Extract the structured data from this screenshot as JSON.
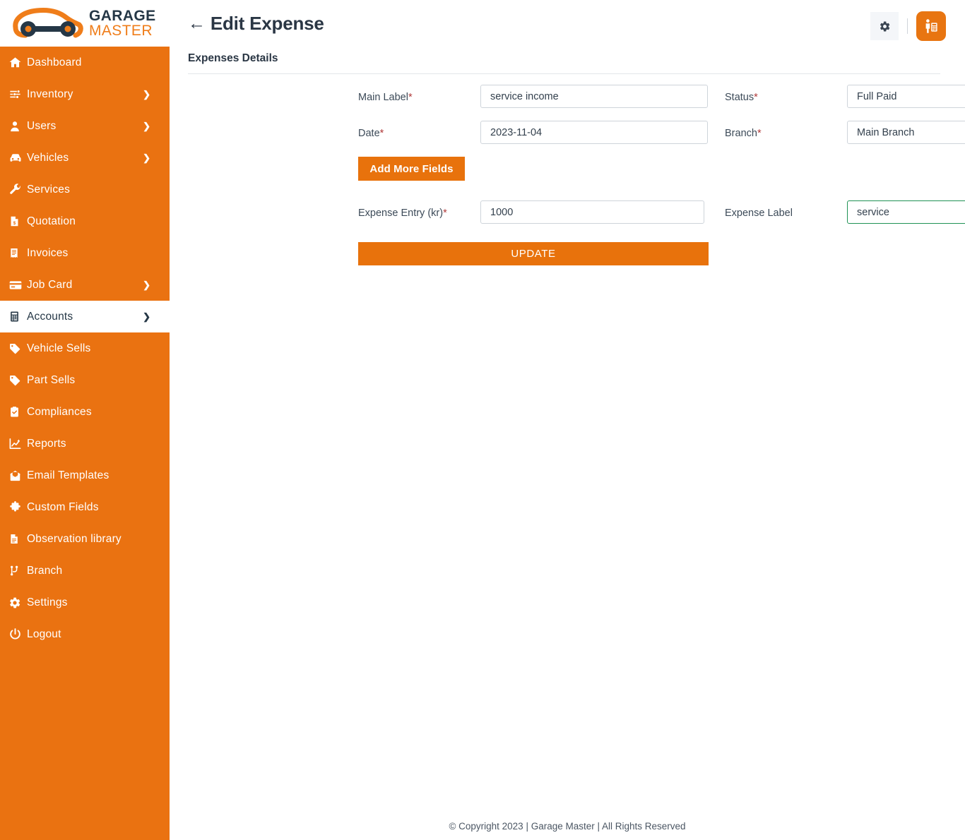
{
  "brand": {
    "line1": "GARAGE",
    "line2": "MASTER",
    "logo_icon": "car-wrench-logo"
  },
  "sidebar": {
    "items": [
      {
        "label": "Dashboard",
        "icon": "home-icon",
        "chevron": false,
        "active": false
      },
      {
        "label": "Inventory",
        "icon": "sliders-icon",
        "chevron": true,
        "active": false
      },
      {
        "label": "Users",
        "icon": "user-icon",
        "chevron": true,
        "active": false
      },
      {
        "label": "Vehicles",
        "icon": "car-icon",
        "chevron": true,
        "active": false
      },
      {
        "label": "Services",
        "icon": "wrench-icon",
        "chevron": false,
        "active": false
      },
      {
        "label": "Quotation",
        "icon": "file-dollar-icon",
        "chevron": false,
        "active": false
      },
      {
        "label": "Invoices",
        "icon": "receipt-icon",
        "chevron": false,
        "active": false
      },
      {
        "label": "Job Card",
        "icon": "card-icon",
        "chevron": true,
        "active": false
      },
      {
        "label": "Accounts",
        "icon": "calculator-icon",
        "chevron": true,
        "active": true
      },
      {
        "label": "Vehicle Sells",
        "icon": "tag-icon",
        "chevron": false,
        "active": false
      },
      {
        "label": "Part Sells",
        "icon": "tag-icon",
        "chevron": false,
        "active": false
      },
      {
        "label": "Compliances",
        "icon": "clipboard-check-icon",
        "chevron": false,
        "active": false
      },
      {
        "label": "Reports",
        "icon": "chart-line-icon",
        "chevron": false,
        "active": false
      },
      {
        "label": "Email Templates",
        "icon": "mail-open-icon",
        "chevron": false,
        "active": false
      },
      {
        "label": "Custom Fields",
        "icon": "puzzle-icon",
        "chevron": false,
        "active": false
      },
      {
        "label": "Observation library",
        "icon": "document-icon",
        "chevron": false,
        "active": false
      },
      {
        "label": "Branch",
        "icon": "branch-icon",
        "chevron": false,
        "active": false
      },
      {
        "label": "Settings",
        "icon": "gear-icon",
        "chevron": false,
        "active": false
      },
      {
        "label": "Logout",
        "icon": "power-icon",
        "chevron": false,
        "active": false
      }
    ]
  },
  "topbar": {
    "back_arrow": "←",
    "title": "Edit Expense",
    "gear_icon": "gear-icon",
    "profile_icon": "accountant-person-icon"
  },
  "content": {
    "section_title": "Expenses Details",
    "fields": {
      "main_label": {
        "label": "Main Label",
        "required": "*",
        "value": "service income",
        "placeholder": "Main Label"
      },
      "status": {
        "label": "Status",
        "required": "*",
        "value": "Full Paid",
        "placeholder": "Status"
      },
      "date": {
        "label": "Date",
        "required": "*",
        "value": "2023-11-04",
        "placeholder": "Date"
      },
      "branch": {
        "label": "Branch",
        "required": "*",
        "value": "Main Branch",
        "placeholder": "Branch"
      },
      "expense_entry": {
        "label": "Expense Entry (kr)",
        "required": "*",
        "value": "1000",
        "placeholder": "Expense Entry"
      },
      "expense_label": {
        "label": "Expense Label",
        "required": "",
        "value": "service",
        "placeholder": "Expense Label",
        "valid": true,
        "check_glyph": "✔"
      }
    },
    "add_more_label": "Add More Fields",
    "update_label": "UPDATE"
  },
  "footer": {
    "text": "© Copyright 2023 | Garage Master | All Rights Reserved"
  },
  "colors": {
    "brand_orange": "#ea7211",
    "button_orange": "#e8720c",
    "text_dark": "#2a3644",
    "valid_green": "#1f9254",
    "required_red": "#b03a3a"
  }
}
